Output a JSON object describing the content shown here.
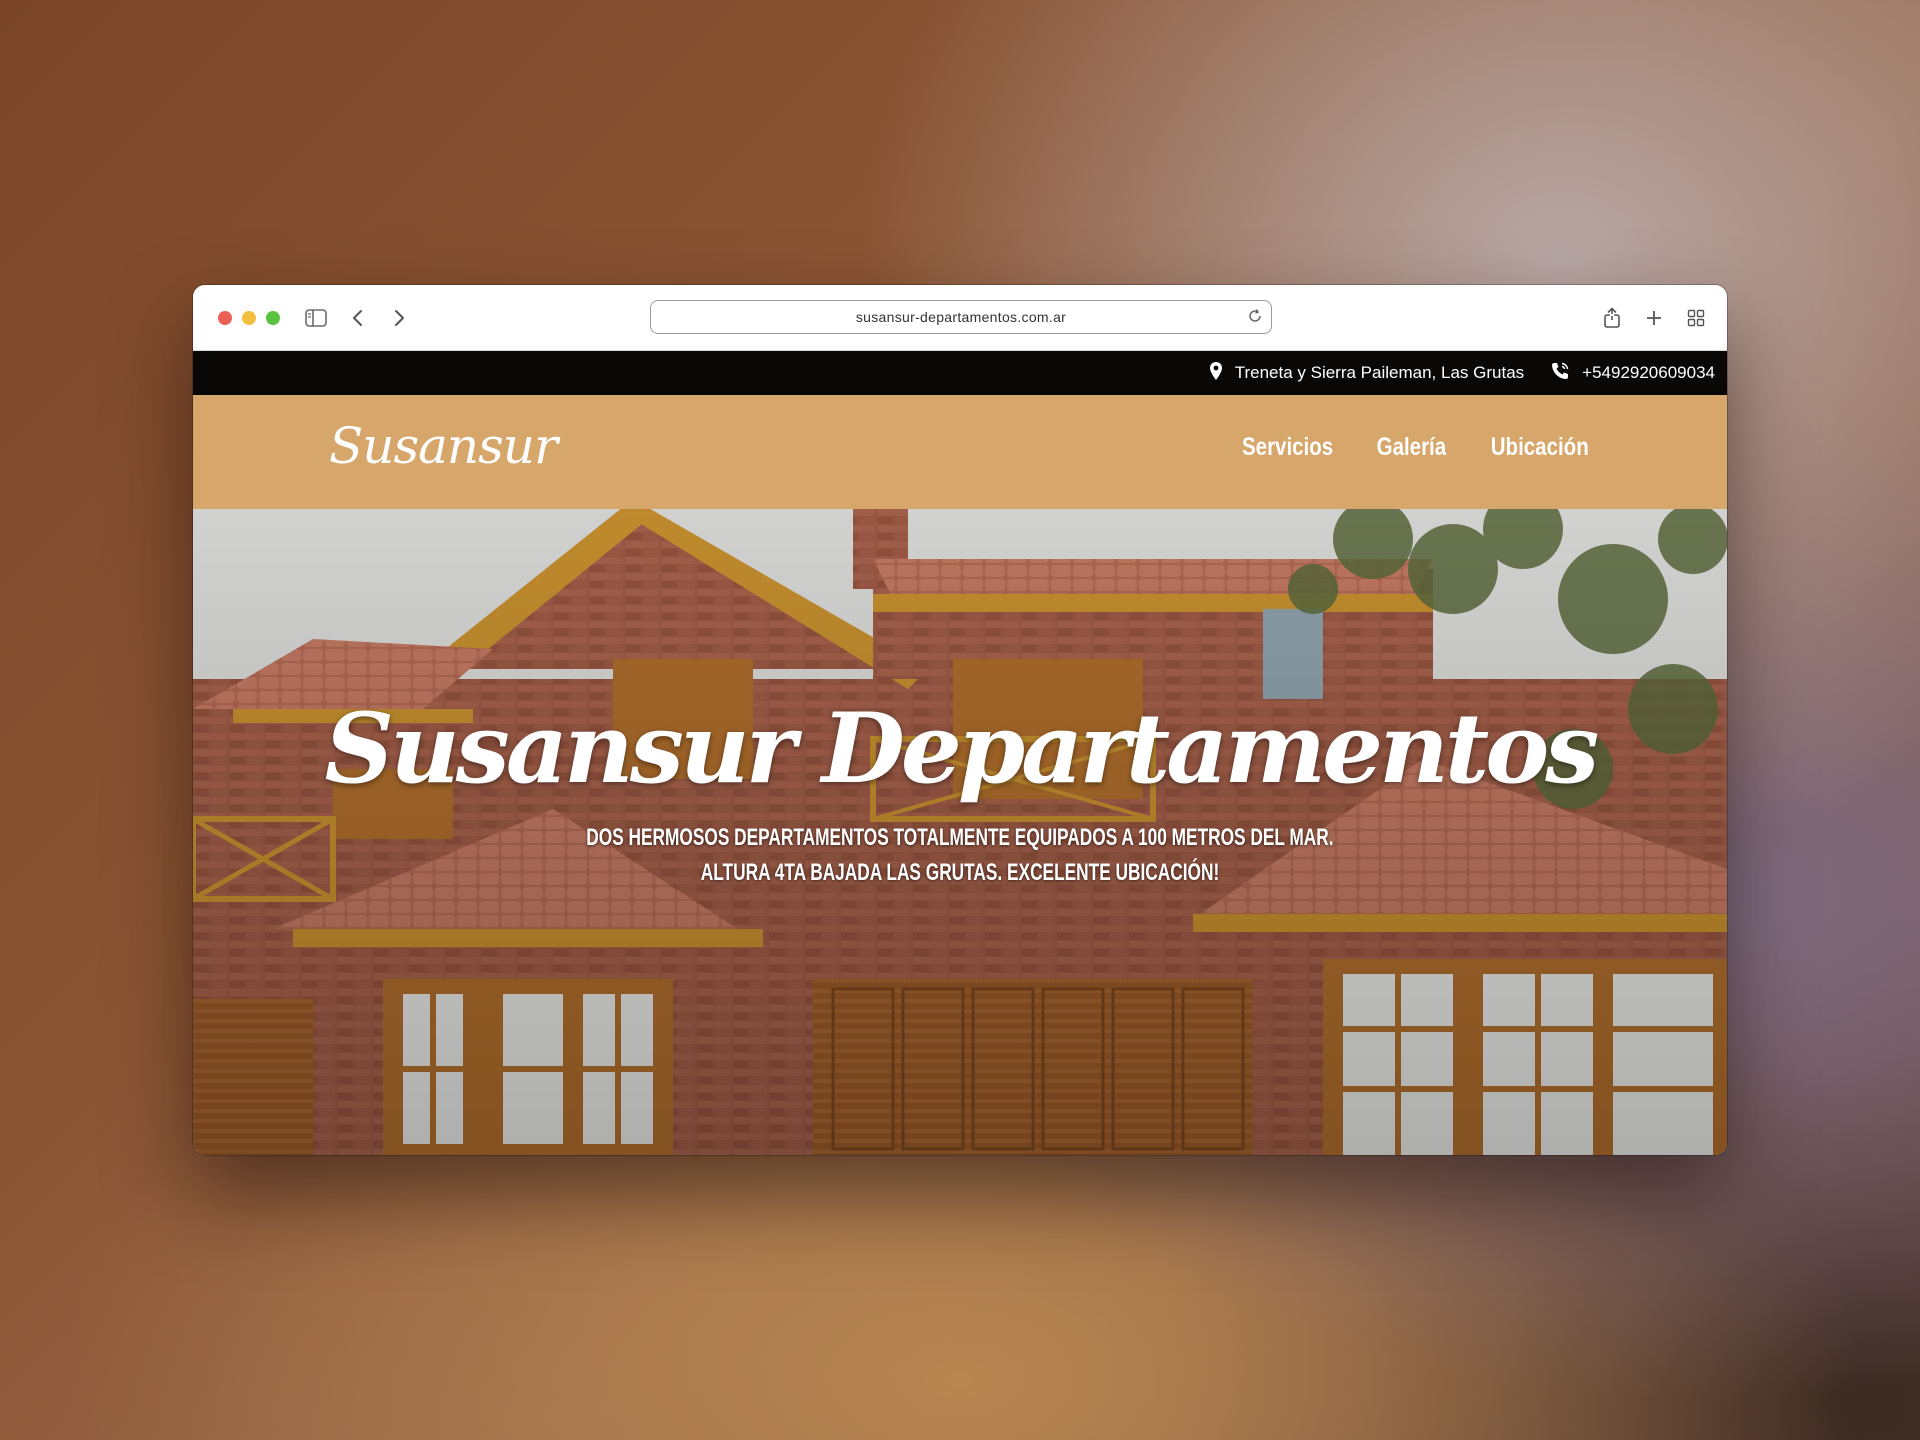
{
  "browser": {
    "url": "susansur-departamentos.com.ar",
    "icons": [
      "sidebar-icon",
      "back-icon",
      "forward-icon",
      "reload-icon",
      "share-icon",
      "new-tab-icon",
      "tab-overview-icon"
    ]
  },
  "topbar": {
    "address": "Treneta y Sierra Paileman, Las Grutas",
    "phone": "+5492920609034",
    "icons": [
      "location-pin-icon",
      "phone-icon"
    ]
  },
  "navbar": {
    "logo": "Susansur",
    "links": [
      "Servicios",
      "Galería",
      "Ubicación"
    ],
    "background": "#d6a66a"
  },
  "hero": {
    "title": "Susansur Departamentos",
    "subtitle_line1": "Dos hermosos departamentos totalmente equipados a 100 metros del mar.",
    "subtitle_line2": "Altura 4ta bajada Las Grutas. Excelente ubicación!"
  }
}
